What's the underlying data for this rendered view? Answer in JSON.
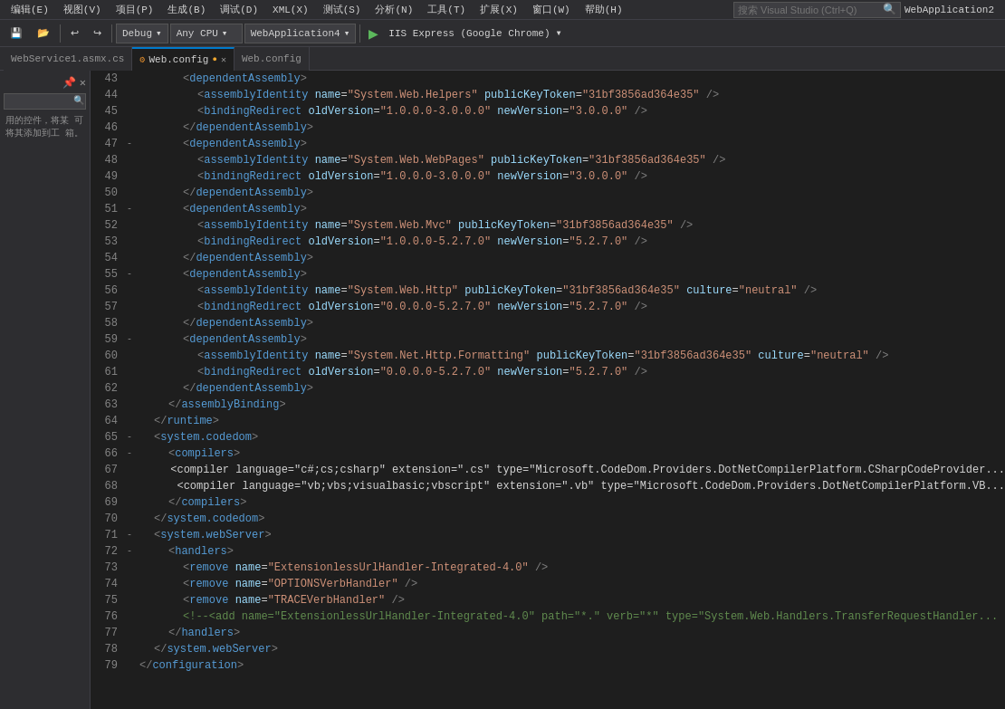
{
  "app": {
    "title": "WebApplication2"
  },
  "menu": {
    "items": [
      "编辑(E)",
      "视图(V)",
      "项目(P)",
      "生成(B)",
      "调试(D)",
      "XML(X)",
      "测试(S)",
      "分析(N)",
      "工具(T)",
      "扩展(X)",
      "窗口(W)",
      "帮助(H)"
    ]
  },
  "toolbar": {
    "undo": "↩",
    "redo": "↪",
    "config_label": "Debug",
    "platform_label": "Any CPU",
    "project_label": "WebApplication4",
    "run_btn": "▶",
    "run_label": "IIS Express (Google Chrome)"
  },
  "tabs": [
    {
      "label": "WebService1.asmx.cs",
      "active": false,
      "closable": false
    },
    {
      "label": "Web.config",
      "active": true,
      "closable": true,
      "has_dot": true
    },
    {
      "label": "Web.config",
      "active": false,
      "closable": false
    }
  ],
  "sidebar": {
    "text": "用的控件，将某\n可将其添加到工\n箱。"
  },
  "code": {
    "lines": [
      {
        "ln": 43,
        "fold": "",
        "content": "<dependentAssembly>",
        "indent": 3,
        "type": "open"
      },
      {
        "ln": 44,
        "fold": "",
        "content": "<assemblyIdentity name=\"System.Web.Helpers\" publicKeyToken=\"31bf3856ad364e35\" />",
        "indent": 4,
        "type": "self-close"
      },
      {
        "ln": 45,
        "fold": "",
        "content": "<bindingRedirect oldVersion=\"1.0.0.0-3.0.0.0\" newVersion=\"3.0.0.0\" />",
        "indent": 4,
        "type": "self-close"
      },
      {
        "ln": 46,
        "fold": "",
        "content": "</dependentAssembly>",
        "indent": 3,
        "type": "close"
      },
      {
        "ln": 47,
        "fold": "-",
        "content": "<dependentAssembly>",
        "indent": 3,
        "type": "open"
      },
      {
        "ln": 48,
        "fold": "",
        "content": "<assemblyIdentity name=\"System.Web.WebPages\" publicKeyToken=\"31bf3856ad364e35\" />",
        "indent": 4,
        "type": "self-close"
      },
      {
        "ln": 49,
        "fold": "",
        "content": "<bindingRedirect oldVersion=\"1.0.0.0-3.0.0.0\" newVersion=\"3.0.0.0\" />",
        "indent": 4,
        "type": "self-close"
      },
      {
        "ln": 50,
        "fold": "",
        "content": "</dependentAssembly>",
        "indent": 3,
        "type": "close"
      },
      {
        "ln": 51,
        "fold": "-",
        "content": "<dependentAssembly>",
        "indent": 3,
        "type": "open"
      },
      {
        "ln": 52,
        "fold": "",
        "content": "<assemblyIdentity name=\"System.Web.Mvc\" publicKeyToken=\"31bf3856ad364e35\" />",
        "indent": 4,
        "type": "self-close"
      },
      {
        "ln": 53,
        "fold": "",
        "content": "<bindingRedirect oldVersion=\"1.0.0.0-5.2.7.0\" newVersion=\"5.2.7.0\" />",
        "indent": 4,
        "type": "self-close"
      },
      {
        "ln": 54,
        "fold": "",
        "content": "</dependentAssembly>",
        "indent": 3,
        "type": "close"
      },
      {
        "ln": 55,
        "fold": "-",
        "content": "<dependentAssembly>",
        "indent": 3,
        "type": "open"
      },
      {
        "ln": 56,
        "fold": "",
        "content": "<assemblyIdentity name=\"System.Web.Http\" publicKeyToken=\"31bf3856ad364e35\" culture=\"neutral\" />",
        "indent": 4,
        "type": "self-close"
      },
      {
        "ln": 57,
        "fold": "",
        "content": "<bindingRedirect oldVersion=\"0.0.0.0-5.2.7.0\" newVersion=\"5.2.7.0\" />",
        "indent": 4,
        "type": "self-close"
      },
      {
        "ln": 58,
        "fold": "",
        "content": "</dependentAssembly>",
        "indent": 3,
        "type": "close"
      },
      {
        "ln": 59,
        "fold": "-",
        "content": "<dependentAssembly>",
        "indent": 3,
        "type": "open"
      },
      {
        "ln": 60,
        "fold": "",
        "content": "<assemblyIdentity name=\"System.Net.Http.Formatting\" publicKeyToken=\"31bf3856ad364e35\" culture=\"neutral\" />",
        "indent": 4,
        "type": "self-close"
      },
      {
        "ln": 61,
        "fold": "",
        "content": "<bindingRedirect oldVersion=\"0.0.0.0-5.2.7.0\" newVersion=\"5.2.7.0\" />",
        "indent": 4,
        "type": "self-close"
      },
      {
        "ln": 62,
        "fold": "",
        "content": "</dependentAssembly>",
        "indent": 3,
        "type": "close"
      },
      {
        "ln": 63,
        "fold": "",
        "content": "</assemblyBinding>",
        "indent": 2,
        "type": "close"
      },
      {
        "ln": 64,
        "fold": "",
        "content": "</runtime>",
        "indent": 1,
        "type": "close"
      },
      {
        "ln": 65,
        "fold": "-",
        "content": "<system.codedom>",
        "indent": 1,
        "type": "open"
      },
      {
        "ln": 66,
        "fold": "-",
        "content": "<compilers>",
        "indent": 2,
        "type": "open"
      },
      {
        "ln": 67,
        "fold": "",
        "content": "<compiler language=\"c#;cs;csharp\" extension=\".cs\" type=\"Microsoft.CodeDom.Providers.DotNetCompilerPlatform.CSharpCodeProvider...",
        "indent": 3,
        "type": "self-close"
      },
      {
        "ln": 68,
        "fold": "",
        "content": "<compiler language=\"vb;vbs;visualbasic;vbscript\" extension=\".vb\" type=\"Microsoft.CodeDom.Providers.DotNetCompilerPlatform.VB...",
        "indent": 3,
        "type": "self-close"
      },
      {
        "ln": 69,
        "fold": "",
        "content": "</compilers>",
        "indent": 2,
        "type": "close"
      },
      {
        "ln": 70,
        "fold": "",
        "content": "</system.codedom>",
        "indent": 1,
        "type": "close"
      },
      {
        "ln": 71,
        "fold": "-",
        "content": "<system.webServer>",
        "indent": 1,
        "type": "open"
      },
      {
        "ln": 72,
        "fold": "-",
        "content": "<handlers>",
        "indent": 2,
        "type": "open"
      },
      {
        "ln": 73,
        "fold": "",
        "content": "<remove name=\"ExtensionlessUrlHandler-Integrated-4.0\" />",
        "indent": 3,
        "type": "self-close"
      },
      {
        "ln": 74,
        "fold": "",
        "content": "<remove name=\"OPTIONSVerbHandler\" />",
        "indent": 3,
        "type": "self-close"
      },
      {
        "ln": 75,
        "fold": "",
        "content": "<remove name=\"TRACEVerbHandler\" />",
        "indent": 3,
        "type": "self-close"
      },
      {
        "ln": 76,
        "fold": "",
        "content": "<!--<add name=\"ExtensionlessUrlHandler-Integrated-4.0\" path=\"*.\" verb=\"*\" type=\"System.Web.Handlers.TransferRequestHandler...",
        "indent": 3,
        "type": "comment"
      },
      {
        "ln": 77,
        "fold": "",
        "content": "</handlers>",
        "indent": 2,
        "type": "close"
      },
      {
        "ln": 78,
        "fold": "",
        "content": "</system.webServer>",
        "indent": 1,
        "type": "close"
      },
      {
        "ln": 79,
        "fold": "",
        "content": "</configuration>",
        "indent": 0,
        "type": "close"
      }
    ]
  }
}
